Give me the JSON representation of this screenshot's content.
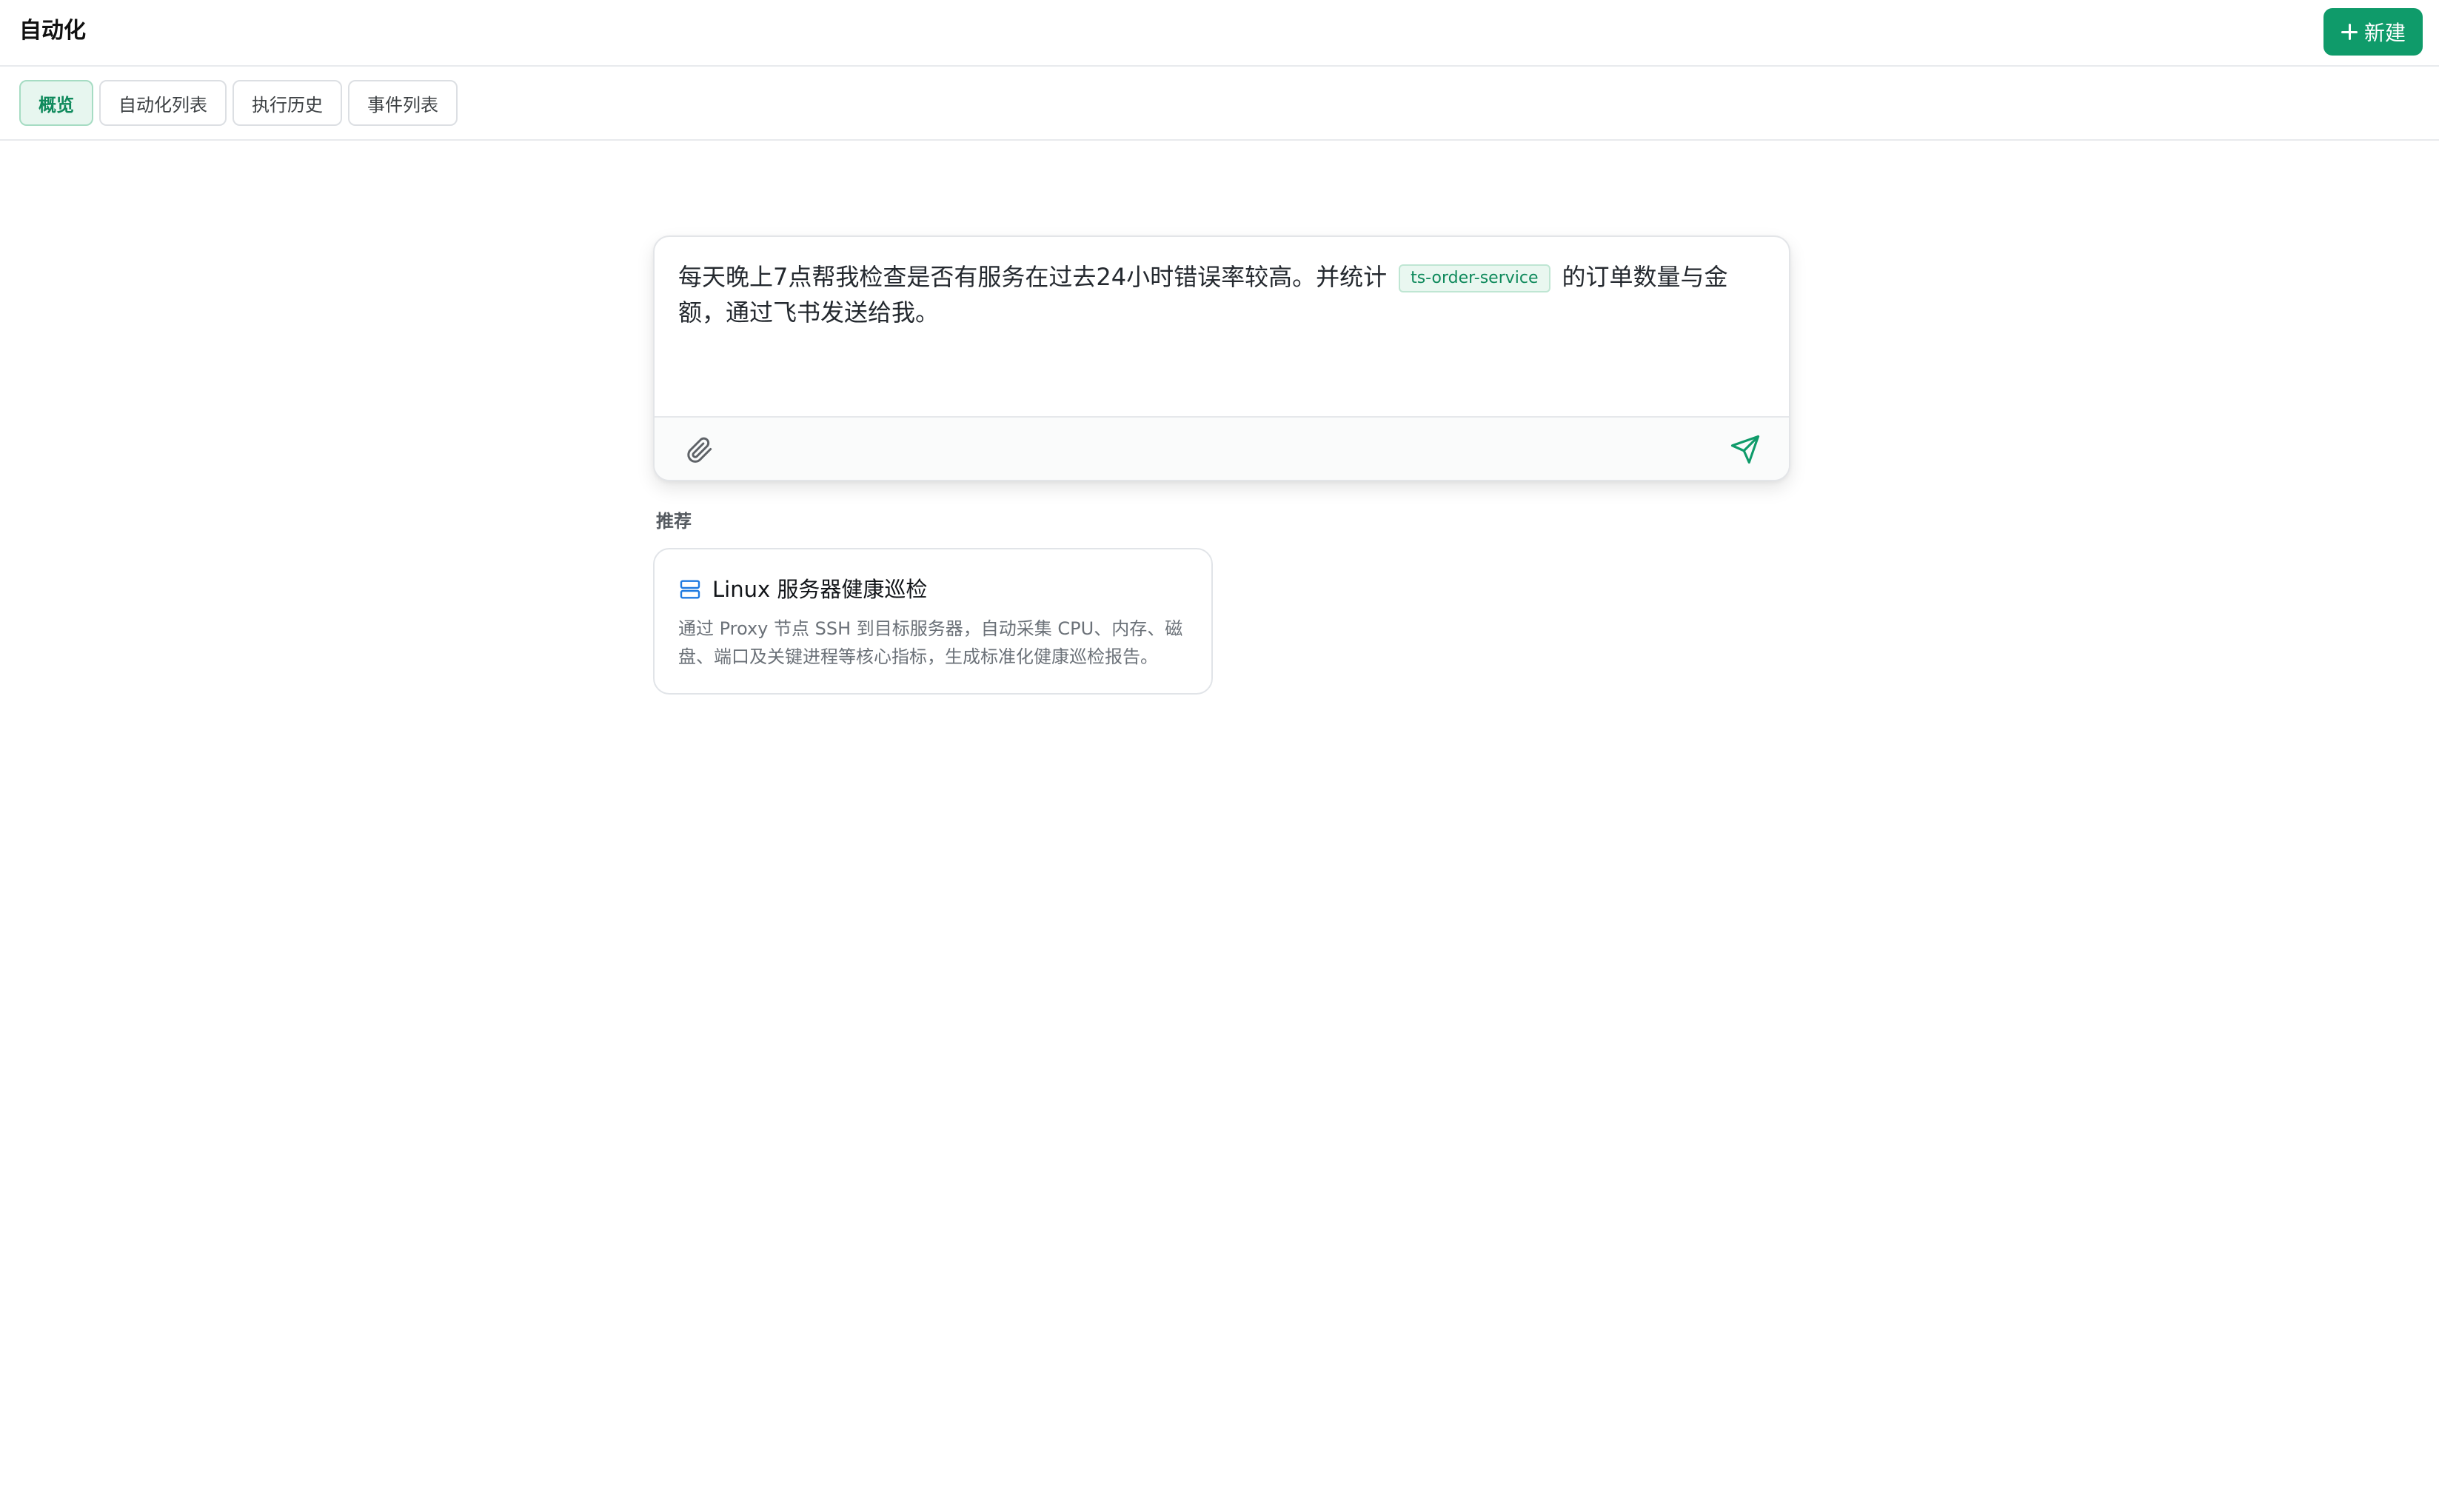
{
  "header": {
    "title": "自动化",
    "new_button_label": "新建",
    "accent_color": "#0f9b6a"
  },
  "tabs": [
    {
      "label": "概览",
      "active": true
    },
    {
      "label": "自动化列表",
      "active": false
    },
    {
      "label": "执行历史",
      "active": false
    },
    {
      "label": "事件列表",
      "active": false
    }
  ],
  "composer": {
    "text_before": "每天晚上7点帮我检查是否有服务在过去24小时错误率较高。并统计",
    "service_tag": "ts-order-service",
    "text_after": "的订单数量与金额，通过飞书发送给我。",
    "attach_icon": "paperclip-icon",
    "send_icon": "send-icon"
  },
  "recommendations": {
    "label": "推荐",
    "items": [
      {
        "icon": "server-icon",
        "title": "Linux 服务器健康巡检",
        "description": "通过 Proxy 节点 SSH 到目标服务器，自动采集 CPU、内存、磁盘、端口及关键进程等核心指标，生成标准化健康巡检报告。"
      }
    ]
  }
}
